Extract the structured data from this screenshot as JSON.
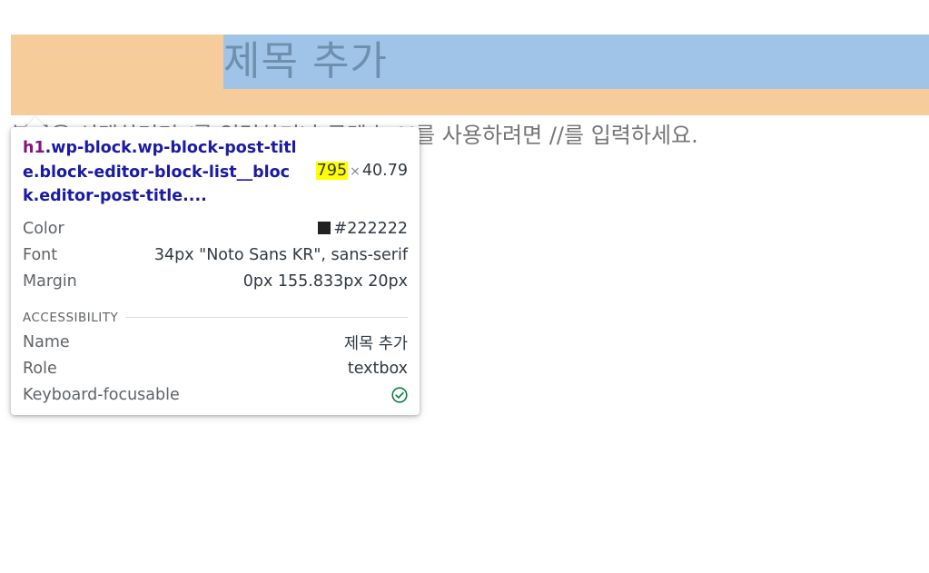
{
  "editor": {
    "post_title": "제목 추가",
    "paragraph_placeholder": "블록을 선택하려면 /를 입력하거나 콘텐츠 AI를 사용하려면 //를 입력하세요."
  },
  "inspector_tooltip": {
    "tag": "h1",
    "selector": ".wp-block.wp-block-post-title.block-editor-block-list__block.editor-post-title....",
    "width": "795",
    "times": "×",
    "height": "40.79",
    "props": [
      {
        "label": "Color",
        "value": "#222222"
      },
      {
        "label": "Font",
        "value": "34px \"Noto Sans KR\", sans-serif"
      },
      {
        "label": "Margin",
        "value": "0px 155.833px 20px"
      }
    ],
    "accessibility_title": "ACCESSIBILITY",
    "accessibility": [
      {
        "label": "Name",
        "value": "제목 추가"
      },
      {
        "label": "Role",
        "value": "textbox"
      },
      {
        "label": "Keyboard-focusable",
        "icon": "check-circle-icon"
      }
    ],
    "colors": {
      "color_swatch": "#222222",
      "check": "#0b8043",
      "highlight": "#ffff00",
      "margin_overlay": "#f6cc9b",
      "content_overlay": "#a0c4e8"
    }
  }
}
